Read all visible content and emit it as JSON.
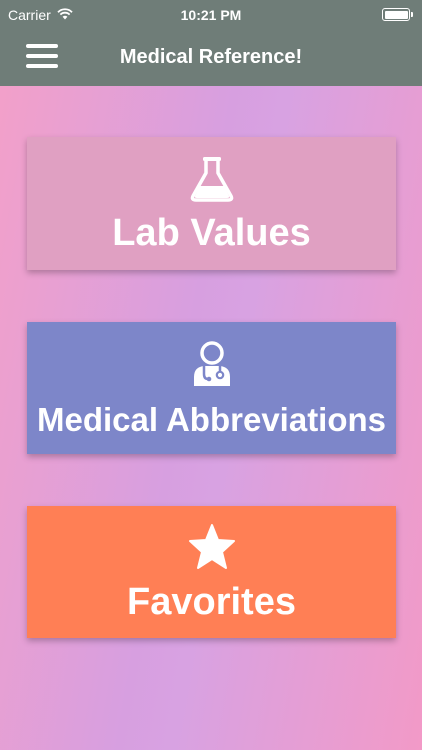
{
  "status_bar": {
    "carrier": "Carrier",
    "time": "10:21 PM",
    "icons": [
      "wifi-icon",
      "battery-icon"
    ]
  },
  "nav": {
    "title": "Medical Reference!",
    "menu_icon": "hamburger-menu-icon"
  },
  "tiles": [
    {
      "label": "Lab Values",
      "icon": "flask-icon",
      "color": "#e0a0c2"
    },
    {
      "label": "Medical Abbreviations",
      "icon": "doctor-icon",
      "color": "#7d86c9"
    },
    {
      "label": "Favorites",
      "icon": "star-icon",
      "color": "#ff7f55"
    }
  ],
  "colors": {
    "nav_background": "#6f7d78",
    "background_gradient": [
      "#f4a0c8",
      "#d79fe0",
      "#f29ac7"
    ]
  }
}
